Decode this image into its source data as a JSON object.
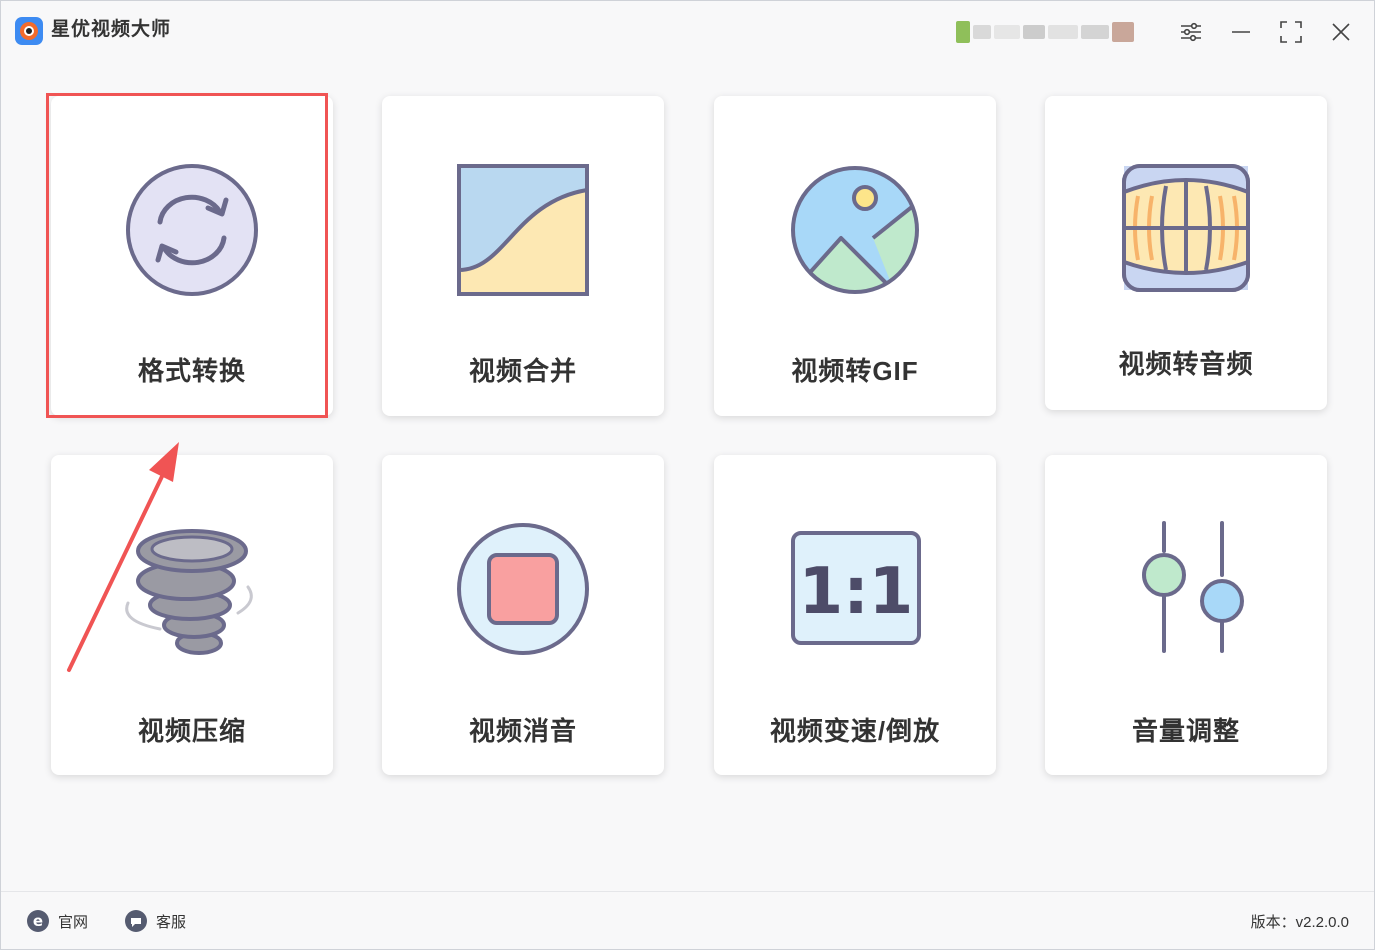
{
  "app": {
    "title": "星优视频大师",
    "logo_icon": "app-logo-icon"
  },
  "titlebar": {
    "user_area_blurred": true,
    "settings_icon": "sliders-icon",
    "minimize_icon": "minimize-icon",
    "maximize_icon": "maximize-icon",
    "close_icon": "close-icon"
  },
  "features": [
    {
      "label": "格式转换",
      "icon": "convert-icon",
      "highlighted": true
    },
    {
      "label": "视频合并",
      "icon": "merge-icon"
    },
    {
      "label": "视频转GIF",
      "icon": "image-gif-icon"
    },
    {
      "label": "视频转音频",
      "icon": "audio-wave-icon"
    },
    {
      "label": "视频压缩",
      "icon": "tornado-icon"
    },
    {
      "label": "视频消音",
      "icon": "stop-icon"
    },
    {
      "label": "视频变速/倒放",
      "icon": "ratio-icon",
      "ratio_text": "1:1"
    },
    {
      "label": "音量调整",
      "icon": "volume-sliders-icon"
    }
  ],
  "footer": {
    "website_label": "官网",
    "support_label": "客服",
    "version_label": "版本：v2.2.0.0"
  },
  "colors": {
    "highlight_border": "#f05454",
    "icon_stroke": "#6b6a8c"
  }
}
